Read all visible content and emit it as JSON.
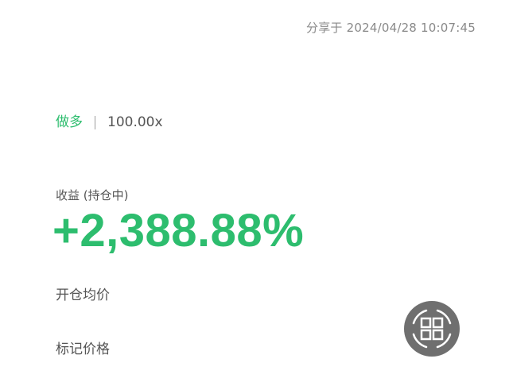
{
  "header": {
    "share_time": "分享于 2024/04/28 10:07:45"
  },
  "position": {
    "side": "做多",
    "leverage": "100.00x"
  },
  "pnl": {
    "label": "收益 (持仓中)",
    "value": "+2,388.88%"
  },
  "details": {
    "entry_price_label": "开仓均价",
    "mark_price_label": "标记价格"
  },
  "icons": {
    "qr_button": "qr-code-icon"
  },
  "colors": {
    "profit_green": "#2dbd6e",
    "text_gray": "#555555",
    "muted_gray": "#8a8a8a",
    "button_gray": "#6f6f6f"
  }
}
